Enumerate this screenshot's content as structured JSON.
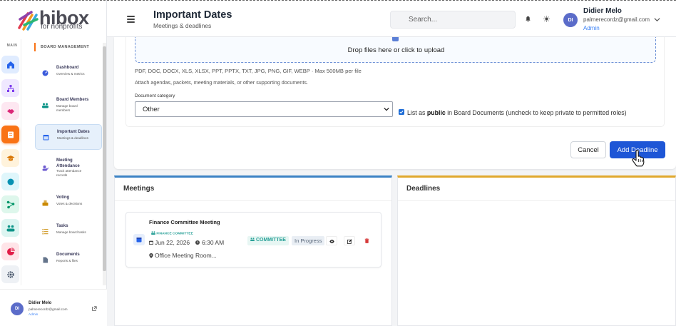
{
  "brand": {
    "name": "hibox",
    "tagline": "for nonprofits"
  },
  "rail": {
    "label": "MAIN",
    "items": [
      {
        "name": "home-icon",
        "color": "#2563eb",
        "bg": "#e0ecff"
      },
      {
        "name": "org-chart-icon",
        "color": "#7c3aed",
        "bg": "#efe8ff"
      },
      {
        "name": "handshake-icon",
        "color": "#db2777",
        "bg": "#fde7f1"
      },
      {
        "name": "board-icon",
        "color": "#ffffff",
        "bg": "#f97316"
      },
      {
        "name": "graduation-icon",
        "color": "#d97706",
        "bg": "#fff3dc"
      },
      {
        "name": "circle-icon",
        "color": "#0891b2",
        "bg": "#dff6fb"
      },
      {
        "name": "network-icon",
        "color": "#059669",
        "bg": "#def7ec"
      },
      {
        "name": "team-icon",
        "color": "#0d9488",
        "bg": "#dcf5f1"
      },
      {
        "name": "pie-icon",
        "color": "#e11d48",
        "bg": "#ffe4e8"
      },
      {
        "name": "gear-icon",
        "color": "#475569",
        "bg": "#eef1f5"
      }
    ]
  },
  "menu": {
    "heading": "BOARD MANAGEMENT",
    "items": [
      {
        "title": "Dashboard",
        "subtitle": "Overview & metrics",
        "icon": "dashboard-icon",
        "color": "#3b5bdb"
      },
      {
        "title": "Board Members",
        "subtitle": "Manage board members",
        "icon": "members-icon",
        "color": "#0d9488"
      },
      {
        "title": "Important Dates",
        "subtitle": "Meetings & deadlines",
        "icon": "calendar-icon",
        "color": "#2563eb"
      },
      {
        "title": "Meeting Attendance",
        "subtitle": "Track attendance records",
        "icon": "attendance-icon",
        "color": "#6d5bd0"
      },
      {
        "title": "Voting",
        "subtitle": "Votes & decisions",
        "icon": "voting-icon",
        "color": "#ca8a04"
      },
      {
        "title": "Tasks",
        "subtitle": "Manage board tasks",
        "icon": "tasks-icon",
        "color": "#ca8a04"
      },
      {
        "title": "Documents",
        "subtitle": "Reports & files",
        "icon": "document-icon",
        "color": "#64748b"
      }
    ]
  },
  "user": {
    "initials": "DI",
    "name": "Didier Melo",
    "email": "palmerecordz@gmail.com",
    "role": "Admin"
  },
  "header": {
    "title": "Important Dates",
    "subtitle": "Meetings & deadlines",
    "search_placeholder": "Search..."
  },
  "form": {
    "drop_text": "Drop files here or click to upload",
    "file_types": "PDF, DOC, DOCX, XLS, XLSX, PPT, PPTX, TXT, JPG, PNG, GIF, WEBP · Max 500MB per file",
    "attach_hint": "Attach agendas, packets, meeting materials, or other supporting documents.",
    "category_label": "Document category",
    "category_value": "Other",
    "public_before": "List as ",
    "public_bold": "public",
    "public_after": " in Board Documents (uncheck to keep private to permitted roles)",
    "cancel_label": "Cancel",
    "add_label": "Add Deadline"
  },
  "meetings": {
    "title": "Meetings",
    "items": [
      {
        "title": "Finance Committee Meeting",
        "tag": "FINANCE COMMITTEE",
        "date": "Jun 22, 2026",
        "time": "6:30 AM",
        "location": "Office Meeting Room...",
        "type_badge": "COMMITTEE",
        "status": "In Progress"
      }
    ]
  },
  "deadlines": {
    "title": "Deadlines"
  }
}
